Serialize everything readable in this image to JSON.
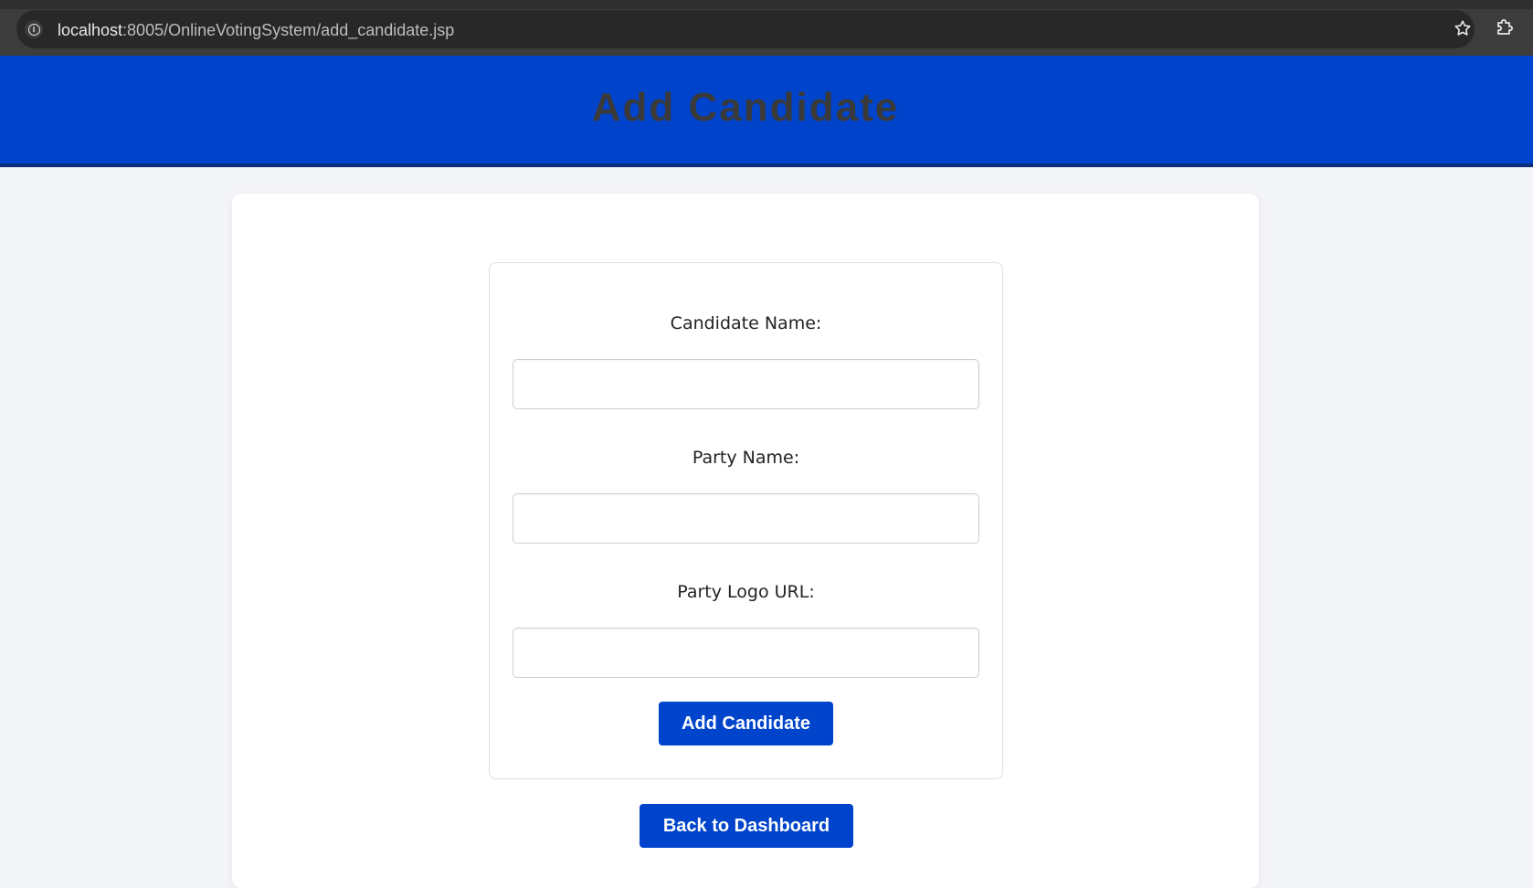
{
  "browser": {
    "url_host": "localhost",
    "url_rest": ":8005/OnlineVotingSystem/add_candidate.jsp",
    "site_info_icon": "info-icon",
    "bookmark_icon": "star-icon",
    "extensions_icon": "puzzle-icon"
  },
  "header": {
    "title": "Add Candidate",
    "background": "#0044cc"
  },
  "form": {
    "fields": [
      {
        "label": "Candidate Name:",
        "value": "",
        "placeholder": ""
      },
      {
        "label": "Party Name:",
        "value": "",
        "placeholder": ""
      },
      {
        "label": "Party Logo URL:",
        "value": "",
        "placeholder": ""
      }
    ],
    "submit_label": "Add Candidate"
  },
  "actions": {
    "back_label": "Back to Dashboard"
  },
  "colors": {
    "accent": "#0044cc",
    "page_background": "#f4f5f9"
  }
}
